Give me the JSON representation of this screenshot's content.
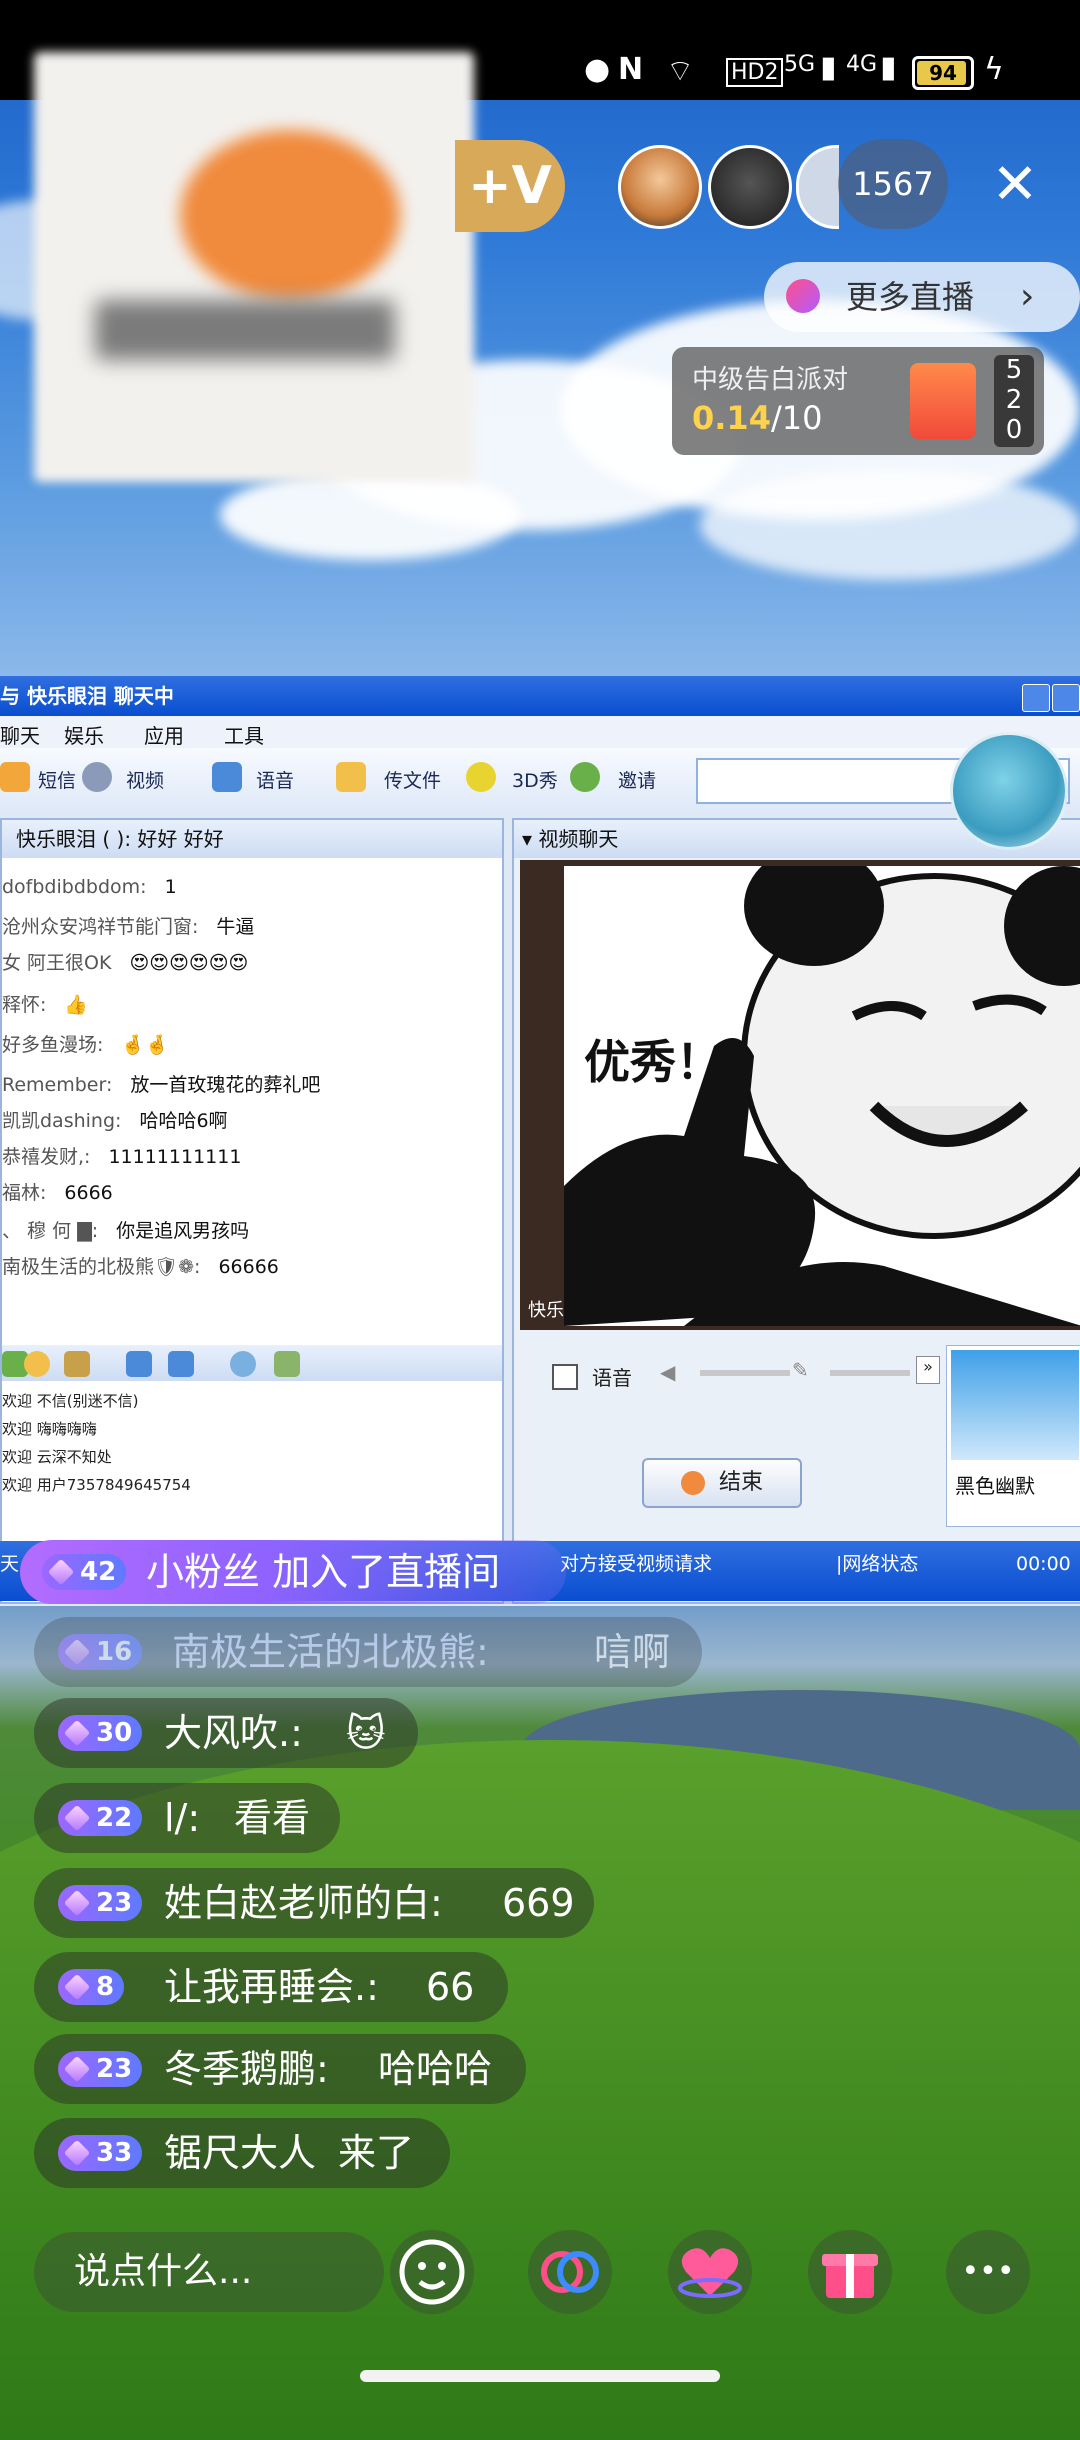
{
  "status_bar": {
    "network_5g": "5G",
    "network_4g": "4G",
    "hd_label": "HD2",
    "nfc_label": "N",
    "battery": "94"
  },
  "streamer": {
    "follow_label": "+V"
  },
  "top_right": {
    "viewer_count": "1567",
    "close_label": "✕"
  },
  "more_live": {
    "label": "更多直播",
    "arrow": "›"
  },
  "event": {
    "title": "中级告白派对",
    "progress_current": "0.14",
    "progress_total": "/10",
    "counter": [
      "5",
      "2",
      "0"
    ]
  },
  "qq_window": {
    "title": "与 快乐眼泪 聊天中",
    "menu": [
      "聊天",
      "娱乐",
      "应用",
      "工具"
    ],
    "toolbar": [
      "短信",
      "视频",
      "语音",
      "传文件",
      "3D秀",
      "邀请"
    ],
    "chat_header": "快乐眼泪 (                ): 好好    好好",
    "messages": [
      {
        "user": "dofbdibdbdom:",
        "text": "1"
      },
      {
        "user": "沧州众安鸿祥节能门窗:",
        "text": "牛逼"
      },
      {
        "user": "女   阿王很OK",
        "text": "😍😍😍😍😍😍"
      },
      {
        "user": "释怀:",
        "text": "👍"
      },
      {
        "user": "好多鱼漫场:",
        "text": "🤞🤞"
      },
      {
        "user": "Remember:",
        "text": "放一首玫瑰花的葬礼吧"
      },
      {
        "user": "凯凯dashing:",
        "text": "哈哈哈6啊"
      },
      {
        "user": "恭禧发财,:",
        "text": "11111111111"
      },
      {
        "user": "  福林:",
        "text": "6666"
      },
      {
        "user": "、 穆 何 ▇:",
        "text": "你是追风男孩吗"
      },
      {
        "user": "南极生活的北极熊🛡❁:",
        "text": "66666"
      }
    ],
    "notices": [
      "欢迎 不信(别迷不信)",
      "欢迎 嗨嗨嗨嗨",
      "欢迎 云深不知处",
      "欢迎 用户7357849645754"
    ],
    "video_header": "▾ 视频聊天",
    "meme_text": "优秀！",
    "video_side_label": "快乐",
    "voice_label": "语音",
    "end_button": "结束",
    "contact_name": "黑色幽默",
    "status_left": "天",
    "status_middle": "对方接受视频请求",
    "status_right": "|网络状态",
    "status_time": "00:00"
  },
  "join_notice": {
    "level": "42",
    "text": "小粉丝 加入了直播间"
  },
  "comments": [
    {
      "level": "16",
      "name": "南极生活的北极熊:",
      "text": "唁啊"
    },
    {
      "level": "30",
      "name": "大风吹.:",
      "text": "🐱"
    },
    {
      "level": "22",
      "name": "l/:",
      "text": "看看"
    },
    {
      "level": "23",
      "name": "姓白赵老师的白:",
      "text": "669"
    },
    {
      "level": "8",
      "name": "让我再睡会.:",
      "text": "66"
    },
    {
      "level": "23",
      "name": "冬季鹅鹏:",
      "text": "哈哈哈"
    },
    {
      "level": "33",
      "name": "锯尺大人",
      "text": "来了"
    }
  ],
  "bottom_bar": {
    "input_placeholder": "说点什么...",
    "more_label": "•••"
  },
  "colors": {
    "accent_purple": "#9b67ff",
    "follow_gold": "#d9a95a",
    "event_gold": "#ffd24c",
    "xp_blue": "#0a4ed0"
  }
}
